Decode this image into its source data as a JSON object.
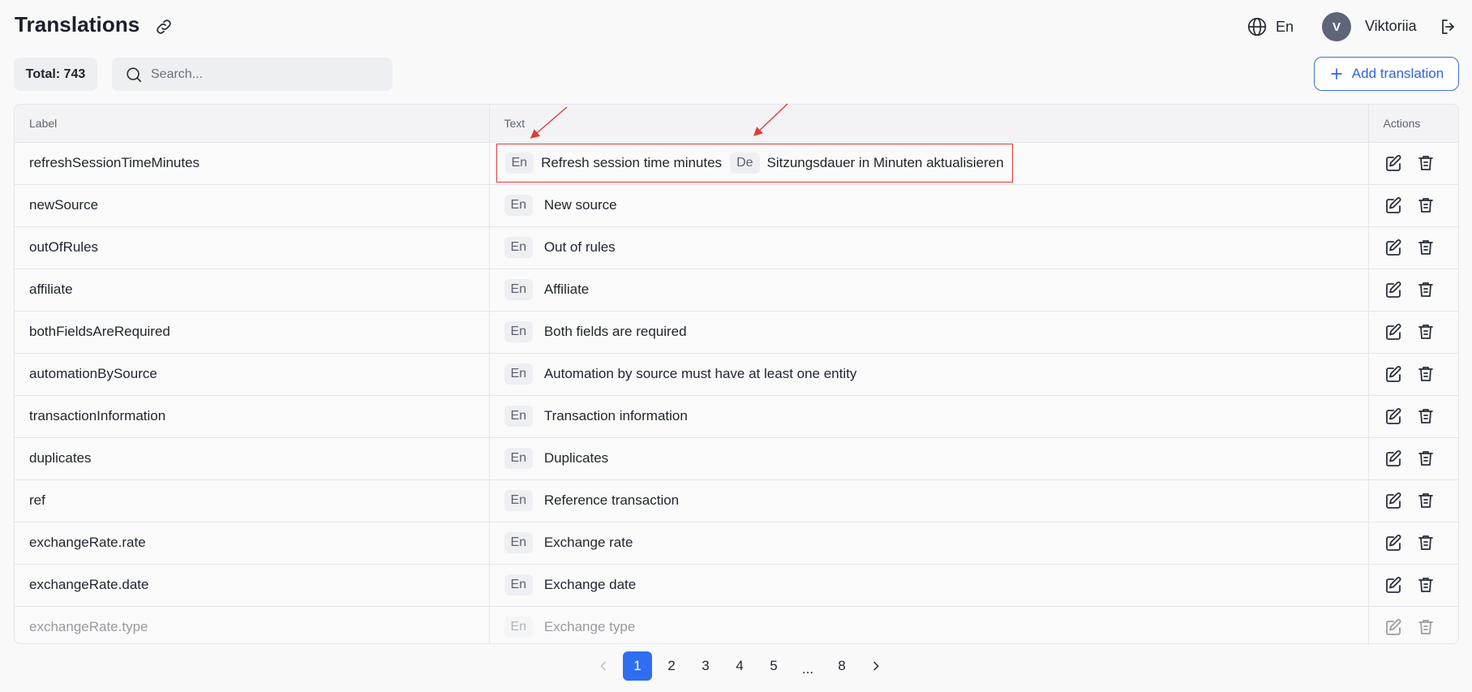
{
  "header": {
    "title": "Translations",
    "language": "En",
    "avatar_initial": "V",
    "user_name": "Viktoriia"
  },
  "toolbar": {
    "total": "Total: 743",
    "search_placeholder": "Search...",
    "add_label": "Add translation"
  },
  "table": {
    "columns": {
      "label": "Label",
      "text": "Text",
      "actions": "Actions"
    },
    "rows": [
      {
        "label": "refreshSessionTimeMinutes",
        "lang": "En",
        "text": "Refresh session time minutes",
        "lang2": "De",
        "text2": "Sitzungsdauer in Minuten aktualisieren"
      },
      {
        "label": "newSource",
        "lang": "En",
        "text": "New source"
      },
      {
        "label": "outOfRules",
        "lang": "En",
        "text": "Out of rules"
      },
      {
        "label": "affiliate",
        "lang": "En",
        "text": "Affiliate"
      },
      {
        "label": "bothFieldsAreRequired",
        "lang": "En",
        "text": "Both fields are required"
      },
      {
        "label": "automationBySource",
        "lang": "En",
        "text": "Automation by source must have at least one entity"
      },
      {
        "label": "transactionInformation",
        "lang": "En",
        "text": "Transaction information"
      },
      {
        "label": "duplicates",
        "lang": "En",
        "text": "Duplicates"
      },
      {
        "label": "ref",
        "lang": "En",
        "text": "Reference transaction"
      },
      {
        "label": "exchangeRate.rate",
        "lang": "En",
        "text": "Exchange rate"
      },
      {
        "label": "exchangeRate.date",
        "lang": "En",
        "text": "Exchange date"
      },
      {
        "label": "exchangeRate.type",
        "lang": "En",
        "text": "Exchange type"
      }
    ]
  },
  "pagination": {
    "pages": [
      "1",
      "2",
      "3",
      "4",
      "5"
    ],
    "ellipsis": "...",
    "last": "8",
    "current": "1"
  },
  "icons": {
    "link": "link-icon",
    "globe": "globe-icon",
    "logout": "logout-icon",
    "search": "search-icon",
    "plus": "plus-icon",
    "edit": "edit-icon",
    "delete": "trash-icon",
    "prev": "chevron-left-icon",
    "next": "chevron-right-icon"
  },
  "colors": {
    "accent": "#2f6ef0",
    "annotation": "#e03a3a",
    "avatar_bg": "#5f6578"
  }
}
